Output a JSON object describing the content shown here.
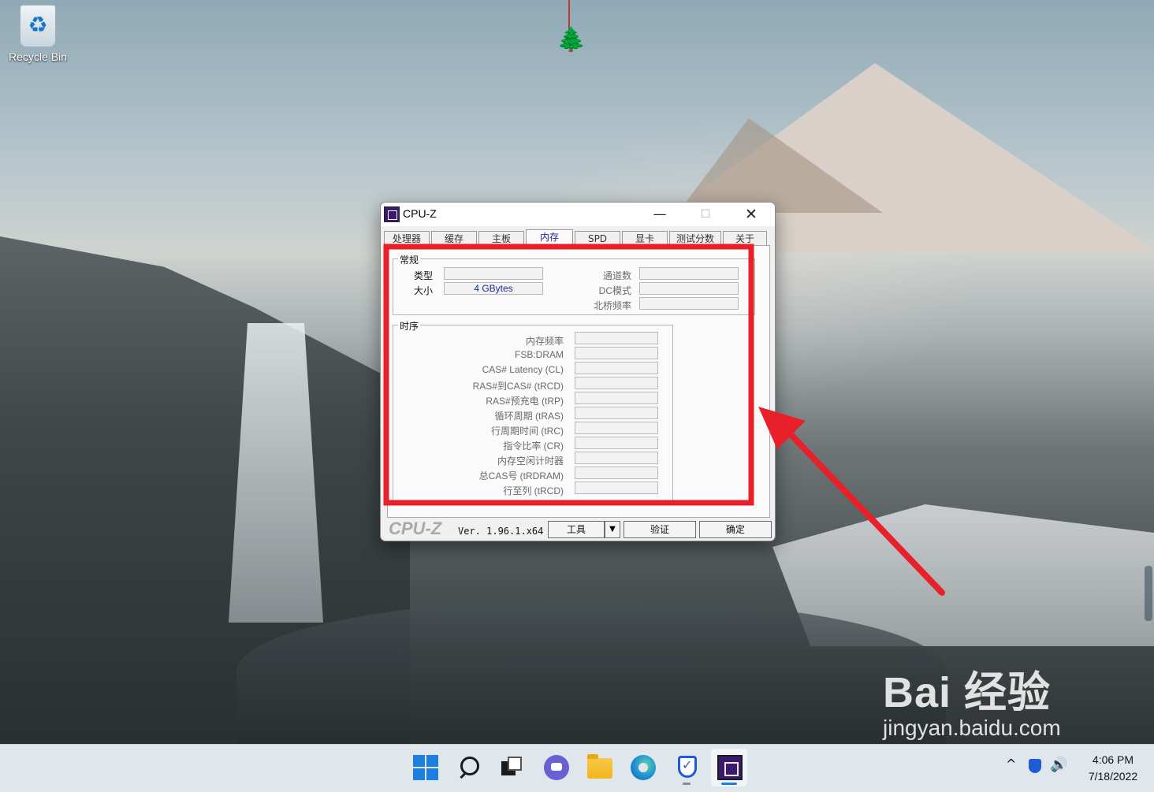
{
  "desktop": {
    "icons": [
      {
        "label": "Recycle Bin",
        "icon": "recycle-bin-icon"
      }
    ]
  },
  "window": {
    "title": "CPU-Z",
    "tabs": [
      {
        "label": "处理器"
      },
      {
        "label": "缓存"
      },
      {
        "label": "主板"
      },
      {
        "label": "内存",
        "active": true
      },
      {
        "label": "SPD"
      },
      {
        "label": "显卡"
      },
      {
        "label": "测试分数"
      },
      {
        "label": "关于"
      }
    ],
    "general": {
      "title": "常规",
      "type_label": "类型",
      "type_value": "",
      "size_label": "大小",
      "size_value": "4 GBytes",
      "channels_label": "通道数",
      "channels_value": "",
      "dc_mode_label": "DC模式",
      "dc_mode_value": "",
      "nb_freq_label": "北桥频率",
      "nb_freq_value": ""
    },
    "timings": {
      "title": "时序",
      "rows": [
        {
          "label": "内存频率",
          "value": ""
        },
        {
          "label": "FSB:DRAM",
          "value": ""
        },
        {
          "label": "CAS# Latency (CL)",
          "value": ""
        },
        {
          "label": "RAS#到CAS# (tRCD)",
          "value": ""
        },
        {
          "label": "RAS#预充电 (tRP)",
          "value": ""
        },
        {
          "label": "循环周期 (tRAS)",
          "value": ""
        },
        {
          "label": "行周期时间 (tRC)",
          "value": ""
        },
        {
          "label": "指令比率 (CR)",
          "value": ""
        },
        {
          "label": "内存空闲计时器",
          "value": ""
        },
        {
          "label": "总CAS号 (tRDRAM)",
          "value": ""
        },
        {
          "label": "行至列 (tRCD)",
          "value": ""
        }
      ]
    },
    "footer": {
      "brand": "CPU-Z",
      "version": "Ver. 1.96.1.x64",
      "tools_label": "工具",
      "validate_label": "验证",
      "ok_label": "确定"
    }
  },
  "annotation": {
    "color": "#e8202a"
  },
  "watermark": {
    "logo": "Bai 经验",
    "url": "jingyan.baidu.com"
  },
  "taskbar": {
    "apps": [
      "start-icon",
      "search-icon",
      "task-view-icon",
      "chat-icon",
      "file-explorer-icon",
      "edge-icon",
      "security-shield-icon",
      "cpuz-app-icon"
    ],
    "clock_time": "4:06 PM",
    "clock_date": "7/18/2022",
    "tray_chevron": "^",
    "tray_sound": "🔊",
    "accent": "#1d7fe0"
  }
}
